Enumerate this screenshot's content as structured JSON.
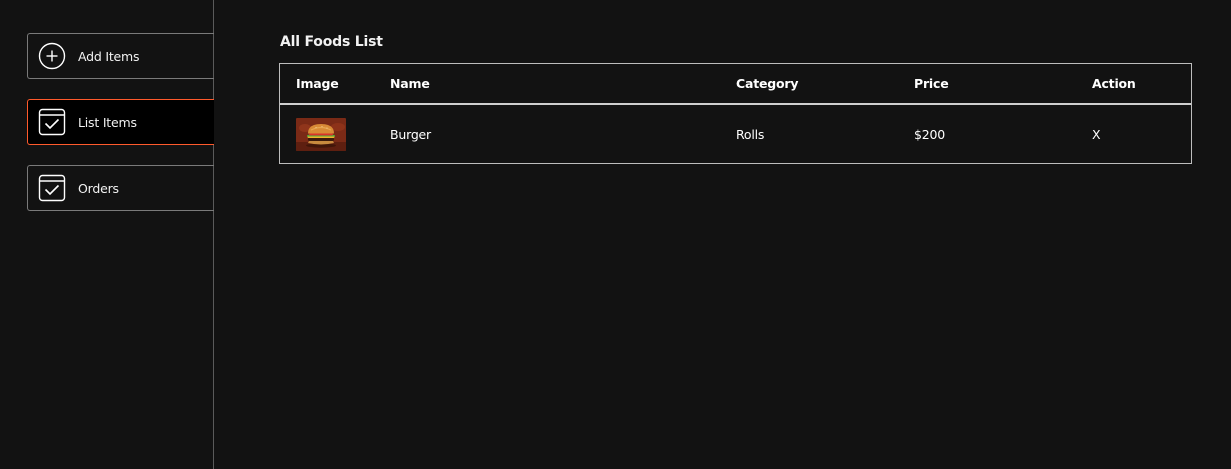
{
  "sidebar": {
    "items": [
      {
        "label": "Add Items",
        "icon": "add-circle-icon",
        "active": false
      },
      {
        "label": "List Items",
        "icon": "checkbox-list-icon",
        "active": true
      },
      {
        "label": "Orders",
        "icon": "checkbox-orders-icon",
        "active": false
      }
    ]
  },
  "colors": {
    "background": "#121212",
    "active_accent": "#ff5a2c",
    "border": "#bdbdbd",
    "text": "#ffffff"
  },
  "main": {
    "title": "All Foods List",
    "table": {
      "headers": [
        "Image",
        "Name",
        "Category",
        "Price",
        "Action"
      ],
      "rows": [
        {
          "image": "burger-photo",
          "name": "Burger",
          "category": "Rolls",
          "price": "$200",
          "action": "X"
        }
      ]
    }
  }
}
